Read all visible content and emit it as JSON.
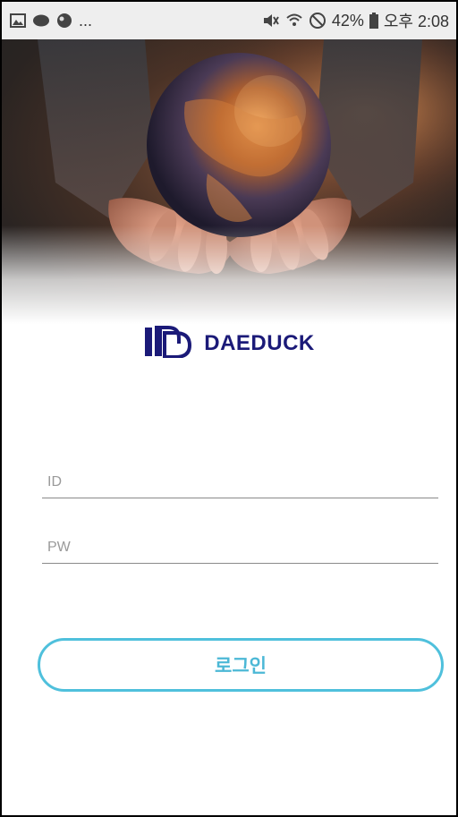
{
  "status_bar": {
    "left_icons": [
      "image-icon",
      "chat-bubble-icon",
      "app-icon"
    ],
    "overflow": "...",
    "right_icons": [
      "mute-icon",
      "wifi-icon",
      "do-not-disturb-icon"
    ],
    "battery": "42%",
    "time": "오후 2:08"
  },
  "logo": {
    "text": "DAEDUCK",
    "color": "#1b1a78"
  },
  "login_form": {
    "id_placeholder": "ID",
    "pw_placeholder": "PW",
    "submit_label": "로그인",
    "accent_color": "#4fc0dc"
  }
}
